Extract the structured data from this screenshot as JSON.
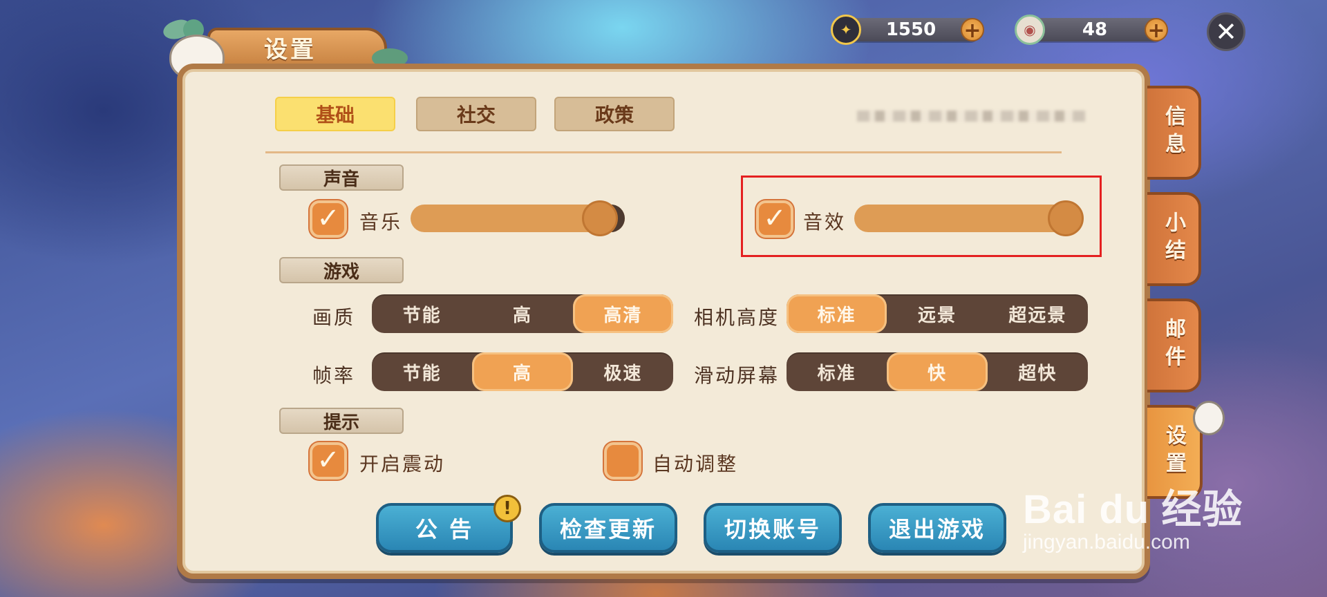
{
  "currencies": [
    {
      "icon": "star-coin-icon",
      "value": "1550",
      "icon_color": "#f2c74a"
    },
    {
      "icon": "jade-coin-icon",
      "value": "48",
      "icon_color": "#8bc09a"
    }
  ],
  "header": {
    "title": "设置"
  },
  "side_tabs": [
    {
      "label": "信息"
    },
    {
      "label": "小结"
    },
    {
      "label": "邮件"
    },
    {
      "label": "设置",
      "active": true
    }
  ],
  "top_tabs": [
    {
      "label": "基础",
      "active": true
    },
    {
      "label": "社交"
    },
    {
      "label": "政策"
    }
  ],
  "sections": {
    "sound": "声音",
    "game": "游戏",
    "tips": "提示"
  },
  "sound": {
    "music": {
      "label": "音乐",
      "checked": true,
      "level": 0.9
    },
    "effects": {
      "label": "音效",
      "checked": true,
      "level": 1.0
    }
  },
  "game": {
    "quality": {
      "label": "画质",
      "options": [
        "节能",
        "高",
        "高清"
      ],
      "selected": "高清"
    },
    "framerate": {
      "label": "帧率",
      "options": [
        "节能",
        "高",
        "极速"
      ],
      "selected": "高"
    },
    "camera_height": {
      "label": "相机高度",
      "options": [
        "标准",
        "远景",
        "超远景"
      ],
      "selected": "标准"
    },
    "scroll_screen": {
      "label": "滑动屏幕",
      "options": [
        "标准",
        "快",
        "超快"
      ],
      "selected": "快"
    }
  },
  "tips": {
    "vibration": {
      "label": "开启震动",
      "checked": true
    },
    "auto_adjust": {
      "label": "自动调整",
      "checked": false
    }
  },
  "buttons": {
    "notice": "公 告",
    "check_update": "检查更新",
    "switch_account": "切换账号",
    "exit_game": "退出游戏"
  },
  "watermark": {
    "logo": "Bai du 经验",
    "url": "jingyan.baidu.com"
  },
  "colors": {
    "accent": "#f0a253",
    "panel_bg": "#f3ead8",
    "highlight": "#e42020",
    "button_blue": "#2a86b4"
  }
}
